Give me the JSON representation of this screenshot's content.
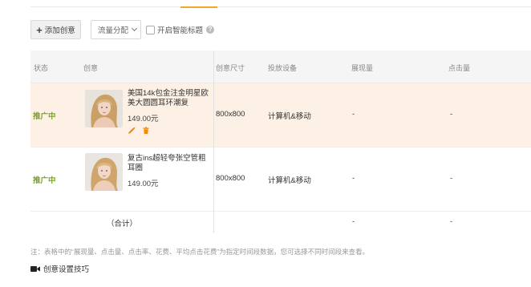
{
  "toolbar": {
    "add_label": "添加创意",
    "add_icon": "plus-icon",
    "traffic_select_value": "流量分配",
    "smart_title_label": "开启智能标题",
    "smart_title_checked": false
  },
  "table": {
    "headers": {
      "status": "状态",
      "creative": "创意",
      "size": "创意尺寸",
      "device": "投放设备",
      "impressions": "展现量",
      "clicks": "点击量"
    },
    "rows": [
      {
        "status": "推广中",
        "name": "美国14k包金注金明星欧美大圆圆耳环潮复",
        "price": "149.00元",
        "size": "800x800",
        "device": "计算机&移动",
        "impressions": "-",
        "clicks": "-",
        "actions": [
          "edit-icon",
          "delete-icon"
        ]
      },
      {
        "status": "推广中",
        "name": "复古ins超轻夸张空管粗耳圈",
        "price": "149.00元",
        "size": "800x800",
        "device": "计算机&移动",
        "impressions": "-",
        "clicks": "-"
      }
    ],
    "total": {
      "label": "（合计）",
      "impressions": "-",
      "clicks": "-"
    }
  },
  "note": "注：表格中的“展现量、点击量、点击率、花费、平均点击花费”为指定时间段数据，您可选择不同时间段来查看。",
  "tip": {
    "label": "创意设置技巧",
    "icon": "video-icon"
  },
  "colors": {
    "active_status": "#7aa321",
    "highlight_row": "#fdf1e6",
    "action_icons": "#f08a00",
    "tab_accent": "#f5a623"
  }
}
